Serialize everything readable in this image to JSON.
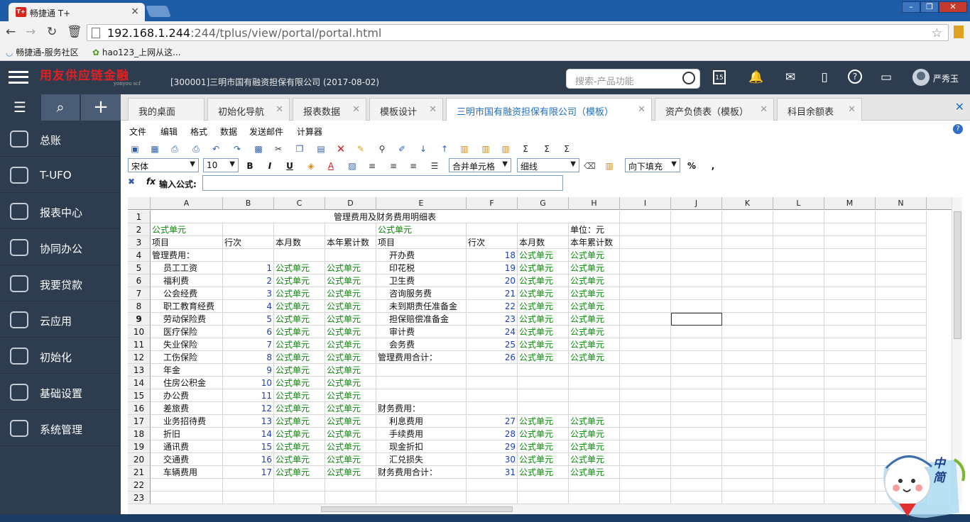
{
  "browser": {
    "tab_title": "畅捷通 T+",
    "tab_favicon": "T+",
    "url_host": "192.168.1.244",
    "url_rest": ":244/tplus/view/portal/portal.html",
    "bookmarks": [
      "畅捷通-服务社区",
      "hao123_上网从这..."
    ]
  },
  "header": {
    "logo": "用友供应链金融",
    "logo_sub": "yonyou scf",
    "company": "[300001]三明市国有融资担保有限公司   (2017-08-02)",
    "search_placeholder": "搜索-产品功能",
    "user": "严秀玉",
    "calendar_day": "15"
  },
  "sidebar": {
    "items": [
      {
        "label": "总账",
        "icon": "ledger-icon"
      },
      {
        "label": "T-UFO",
        "icon": "tufo-icon"
      },
      {
        "label": "报表中心",
        "icon": "report-center-icon"
      },
      {
        "label": "协同办公",
        "icon": "collaboration-icon"
      },
      {
        "label": "我要贷款",
        "icon": "loan-icon"
      },
      {
        "label": "云应用",
        "icon": "cloud-icon"
      },
      {
        "label": "初始化",
        "icon": "init-icon"
      },
      {
        "label": "基础设置",
        "icon": "basic-settings-icon"
      },
      {
        "label": "系统管理",
        "icon": "system-admin-icon"
      }
    ]
  },
  "tabs": [
    {
      "label": "我的桌面",
      "closable": false
    },
    {
      "label": "初始化导航",
      "closable": true
    },
    {
      "label": "报表数据",
      "closable": true
    },
    {
      "label": "模板设计",
      "closable": true
    },
    {
      "label": "三明市国有融资担保有限公司（模板）",
      "closable": true,
      "active": true
    },
    {
      "label": "资产负债表（模板）",
      "closable": true
    },
    {
      "label": "科目余额表",
      "closable": true
    }
  ],
  "menu": [
    "文件",
    "编辑",
    "格式",
    "数据",
    "发送邮件",
    "计算器"
  ],
  "format_bar": {
    "font": "宋体",
    "size": "10",
    "merge": "合并单元格",
    "border": "细线",
    "fill": "向下填充",
    "percent": "%",
    "comma": ","
  },
  "formula_bar": {
    "label": "输入公式:",
    "fx": "fx",
    "value": ""
  },
  "sheet": {
    "columns": [
      "A",
      "B",
      "C",
      "D",
      "E",
      "F",
      "G",
      "H",
      "I",
      "J",
      "K",
      "L",
      "M",
      "N"
    ],
    "title": "管理费用及财务费用明细表",
    "unit": "单位：元",
    "rows": [
      [
        "",
        "",
        "",
        "",
        "",
        "",
        "",
        ""
      ],
      [
        "公式单元",
        "",
        "",
        "",
        "公式单元",
        "",
        "",
        "单位：元"
      ],
      [
        "项目",
        "行次",
        "本月数",
        "本年累计数",
        "项目",
        "行次",
        "本月数",
        "本年累计数"
      ],
      [
        "管理费用：",
        "",
        "",
        "",
        "开办费",
        "18",
        "公式单元",
        "公式单元"
      ],
      [
        "员工工资",
        "1",
        "公式单元",
        "公式单元",
        "印花税",
        "19",
        "公式单元",
        "公式单元"
      ],
      [
        "福利费",
        "2",
        "公式单元",
        "公式单元",
        "卫生费",
        "20",
        "公式单元",
        "公式单元"
      ],
      [
        "公会经费",
        "3",
        "公式单元",
        "公式单元",
        "咨询服务费",
        "21",
        "公式单元",
        "公式单元"
      ],
      [
        "职工教育经费",
        "4",
        "公式单元",
        "公式单元",
        "未到期责任准备金",
        "22",
        "公式单元",
        "公式单元"
      ],
      [
        "劳动保险费",
        "5",
        "公式单元",
        "公式单元",
        "担保赔偿准备金",
        "23",
        "公式单元",
        "公式单元"
      ],
      [
        "医疗保险",
        "6",
        "公式单元",
        "公式单元",
        "审计费",
        "24",
        "公式单元",
        "公式单元"
      ],
      [
        "失业保险",
        "7",
        "公式单元",
        "公式单元",
        "会务费",
        "25",
        "公式单元",
        "公式单元"
      ],
      [
        "工伤保险",
        "8",
        "公式单元",
        "公式单元",
        "管理费用合计：",
        "26",
        "公式单元",
        "公式单元"
      ],
      [
        "年金",
        "9",
        "公式单元",
        "公式单元",
        "",
        "",
        "",
        ""
      ],
      [
        "住房公积金",
        "10",
        "公式单元",
        "公式单元",
        "",
        "",
        "",
        ""
      ],
      [
        "办公费",
        "11",
        "公式单元",
        "公式单元",
        "",
        "",
        "",
        ""
      ],
      [
        "差旅费",
        "12",
        "公式单元",
        "公式单元",
        "财务费用：",
        "",
        "",
        ""
      ],
      [
        "业务招待费",
        "13",
        "公式单元",
        "公式单元",
        "利息费用",
        "27",
        "公式单元",
        "公式单元"
      ],
      [
        "折旧",
        "14",
        "公式单元",
        "公式单元",
        "手续费用",
        "28",
        "公式单元",
        "公式单元"
      ],
      [
        "通讯费",
        "15",
        "公式单元",
        "公式单元",
        "现金折扣",
        "29",
        "公式单元",
        "公式单元"
      ],
      [
        "交通费",
        "16",
        "公式单元",
        "公式单元",
        "汇兑损失",
        "30",
        "公式单元",
        "公式单元"
      ],
      [
        "车辆费用",
        "17",
        "公式单元",
        "公式单元",
        "财务费用合计：",
        "31",
        "公式单元",
        "公式单元"
      ],
      [
        "",
        "",
        "",
        "",
        "",
        "",
        "",
        ""
      ],
      [
        "",
        "",
        "",
        "",
        "",
        "",
        "",
        ""
      ]
    ]
  },
  "mascot_text": "中简"
}
